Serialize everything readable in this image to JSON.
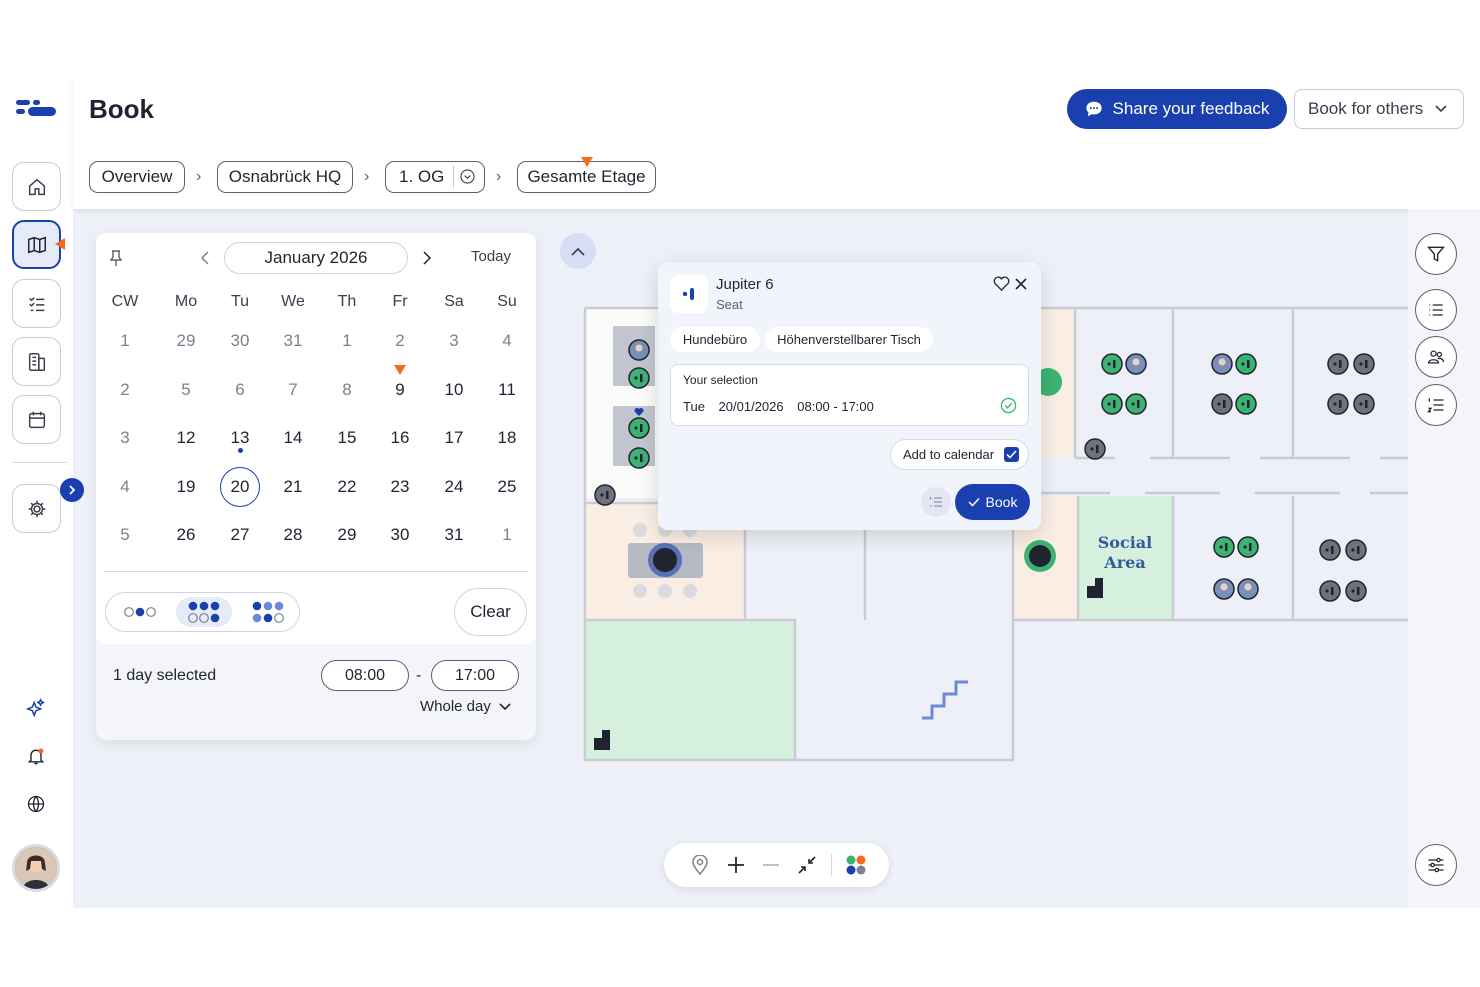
{
  "header": {
    "title": "Book",
    "feedback_label": "Share your feedback",
    "book_for_label": "Book for others"
  },
  "breadcrumb": [
    "Overview",
    "Osnabrück HQ",
    "1. OG",
    "Gesamte Etage"
  ],
  "calendar": {
    "month_label": "January 2026",
    "today_label": "Today",
    "weekdays": [
      "CW",
      "Mo",
      "Tu",
      "We",
      "Th",
      "Fr",
      "Sa",
      "Su"
    ],
    "weeks": [
      [
        "1",
        "29",
        "30",
        "31",
        "1",
        "2",
        "3",
        "4"
      ],
      [
        "2",
        "5",
        "6",
        "7",
        "8",
        "9",
        "10",
        "11"
      ],
      [
        "3",
        "12",
        "13",
        "14",
        "15",
        "16",
        "17",
        "18"
      ],
      [
        "4",
        "19",
        "20",
        "21",
        "22",
        "23",
        "24",
        "25"
      ],
      [
        "5",
        "26",
        "27",
        "28",
        "29",
        "30",
        "31",
        "1"
      ]
    ],
    "selected_day": "20",
    "clear_label": "Clear",
    "days_selected": "1 day selected",
    "start_time": "08:00",
    "end_time": "17:00",
    "time_separator": "-",
    "duration_label": "Whole day"
  },
  "popup": {
    "name": "Jupiter 6",
    "type": "Seat",
    "tags": [
      "Hundebüro",
      "Höhenverstellbarer Tisch"
    ],
    "selection_title": "Your selection",
    "selection_day": "Tue",
    "selection_date": "20/01/2026",
    "selection_time": "08:00 - 17:00",
    "add_to_calendar_label": "Add to calendar",
    "add_to_calendar_checked": true,
    "book_label": "Book"
  },
  "floor": {
    "social_area_label": "Social Area"
  },
  "colors": {
    "primary": "#1a3fae",
    "accent_orange": "#f26b21",
    "available_green": "#3cb371",
    "social_area_fill": "#d5f0dc",
    "room_peach": "#faeee4"
  },
  "icons": {
    "rail": [
      "home-icon",
      "map-icon",
      "checklist-icon",
      "building-icon",
      "calendar-icon",
      "settings-icon",
      "sparkle-icon",
      "bell-icon",
      "globe-icon"
    ],
    "tools": [
      "filter-icon",
      "list-icon",
      "people-icon",
      "numbered-list-icon",
      "sliders-icon"
    ],
    "zoom": [
      "location-pin-icon",
      "zoom-in-icon",
      "zoom-out-icon",
      "collapse-icon",
      "legend-icon"
    ]
  }
}
